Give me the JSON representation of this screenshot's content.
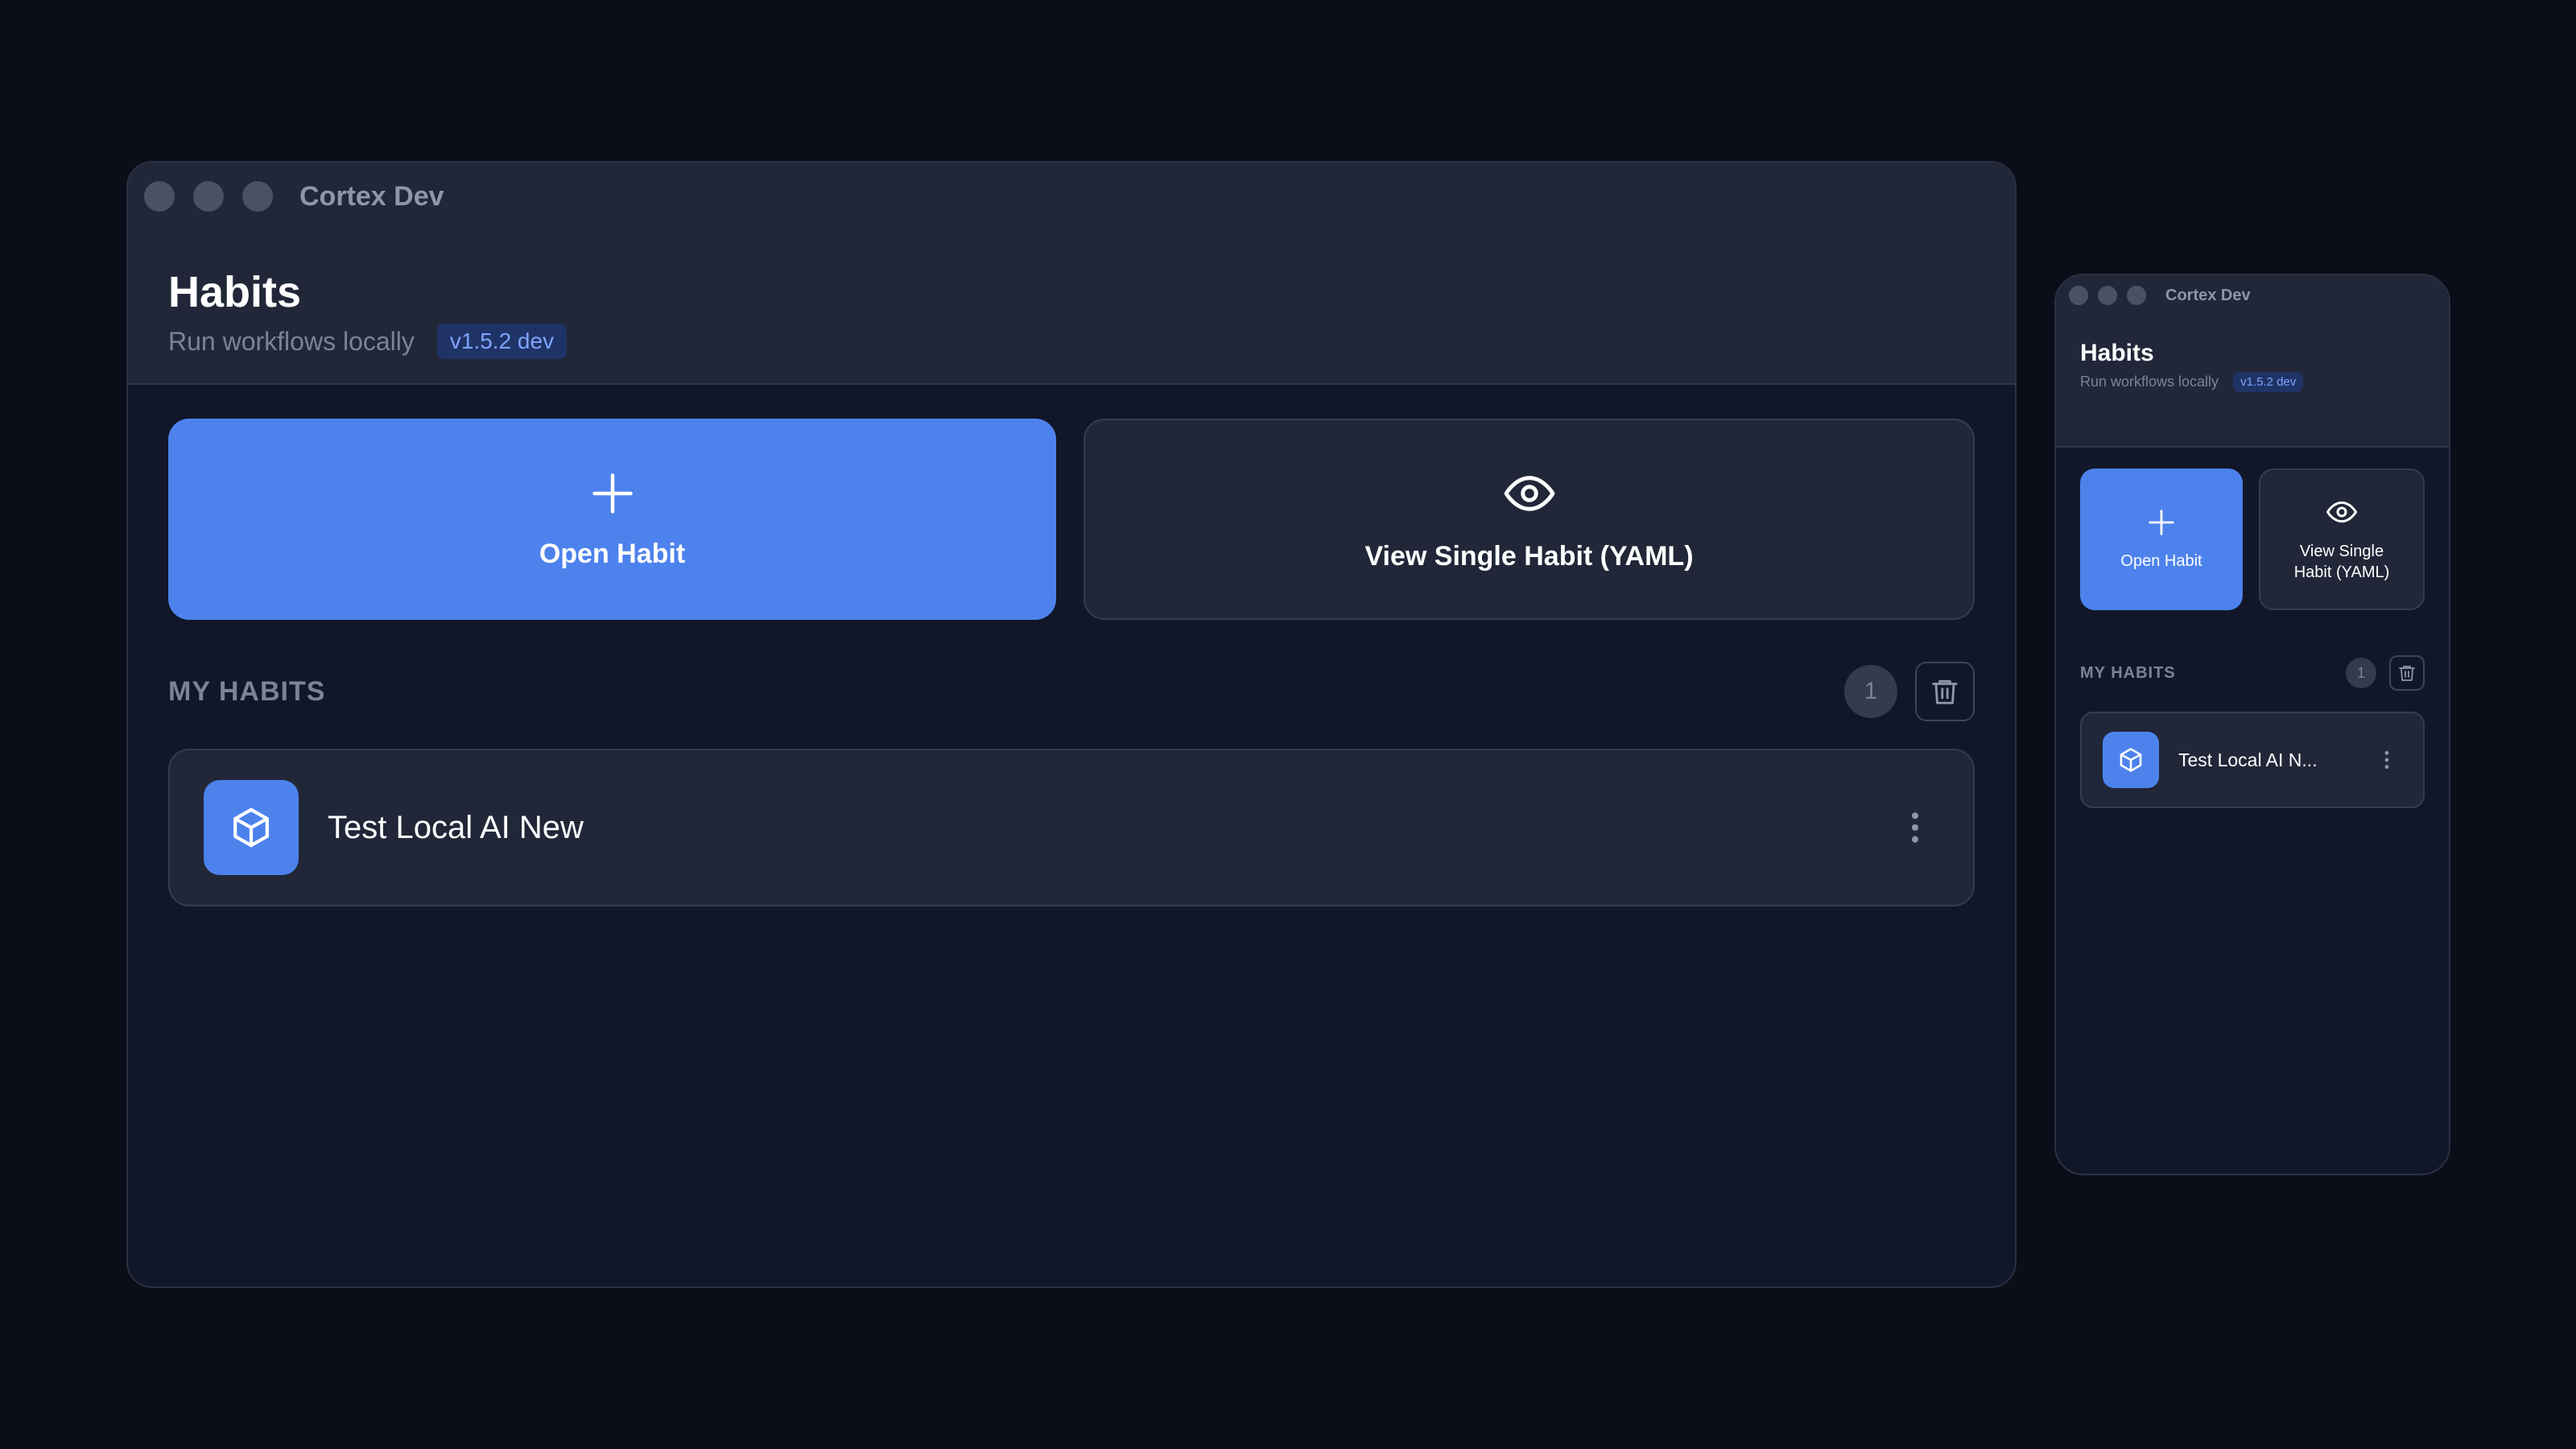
{
  "window_large": {
    "title": "Cortex Dev",
    "page_title": "Habits",
    "subtitle": "Run workflows locally",
    "version": "v1.5.2 dev",
    "open_habit_label": "Open Habit",
    "view_single_label": "View Single Habit (YAML)",
    "section_title": "MY HABITS",
    "habit_count": "1",
    "habits": [
      {
        "name": "Test Local AI New",
        "icon": "cube-icon"
      }
    ]
  },
  "window_small": {
    "title": "Cortex Dev",
    "page_title": "Habits",
    "subtitle": "Run workflows locally",
    "version": "v1.5.2 dev",
    "open_habit_label": "Open Habit",
    "view_single_label_line1": "View Single",
    "view_single_label_line2": "Habit (YAML)",
    "section_title": "MY HABITS",
    "habit_count": "1",
    "habits": [
      {
        "name": "Test Local AI N...",
        "icon": "cube-icon"
      }
    ]
  },
  "colors": {
    "background": "#0b0d18",
    "window": "#111729",
    "header": "#212738",
    "accent": "#4d82ed",
    "badge_bg": "#1f3366",
    "badge_text": "#7ea4ff",
    "muted_text": "#7c8397"
  },
  "icons": [
    "plus-icon",
    "eye-icon",
    "trash-icon",
    "cube-icon",
    "kebab-icon"
  ]
}
